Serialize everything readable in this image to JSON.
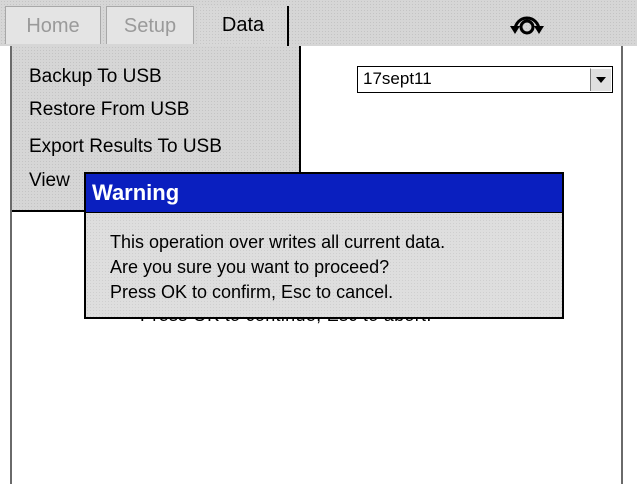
{
  "tabs": [
    {
      "label": "Home",
      "active": false
    },
    {
      "label": "Setup",
      "active": false
    },
    {
      "label": "Data",
      "active": true
    }
  ],
  "sync_icon": "sync-icon",
  "menu": {
    "items": [
      {
        "label": "Backup To USB"
      },
      {
        "label": "Restore From USB"
      },
      {
        "label": "Export Results To USB"
      },
      {
        "label": "View"
      }
    ]
  },
  "dataset_select": {
    "selected": "17sept11"
  },
  "dialog": {
    "title": "Warning",
    "lines": [
      "This operation over writes all current data.",
      "Are you sure you want to proceed?",
      "Press OK to confirm, Esc to cancel."
    ],
    "title_color": "#0a1fbf"
  },
  "background_text": "Press OK to continue, Esc to abort."
}
